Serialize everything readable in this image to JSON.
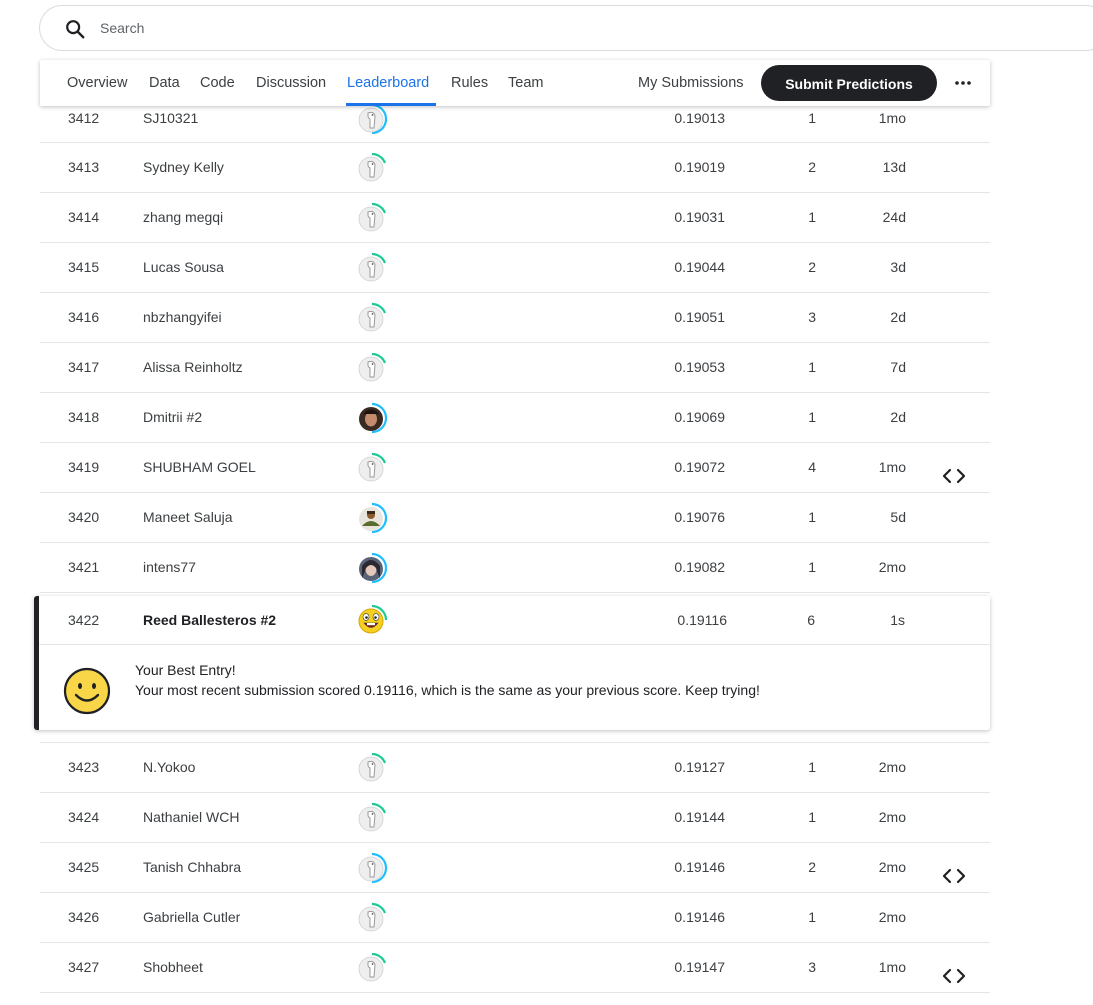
{
  "search": {
    "placeholder": "Search"
  },
  "nav": {
    "tabs": [
      {
        "label": "Overview"
      },
      {
        "label": "Data"
      },
      {
        "label": "Code"
      },
      {
        "label": "Discussion"
      },
      {
        "label": "Leaderboard"
      },
      {
        "label": "Rules"
      },
      {
        "label": "Team"
      }
    ],
    "my_submissions": "My Submissions",
    "submit": "Submit Predictions",
    "active_tab": "Leaderboard"
  },
  "rows_upper": [
    {
      "rank": "3412",
      "name": "SJ10321",
      "score": "0.19013",
      "entries": "1",
      "last": "1mo",
      "code": false,
      "avatar": "default",
      "ring": "blue"
    },
    {
      "rank": "3413",
      "name": "Sydney Kelly",
      "score": "0.19019",
      "entries": "2",
      "last": "13d",
      "code": false,
      "avatar": "default",
      "ring": "green"
    },
    {
      "rank": "3414",
      "name": "zhang megqi",
      "score": "0.19031",
      "entries": "1",
      "last": "24d",
      "code": false,
      "avatar": "default",
      "ring": "green"
    },
    {
      "rank": "3415",
      "name": "Lucas Sousa",
      "score": "0.19044",
      "entries": "2",
      "last": "3d",
      "code": false,
      "avatar": "default",
      "ring": "green"
    },
    {
      "rank": "3416",
      "name": "nbzhangyifei",
      "score": "0.19051",
      "entries": "3",
      "last": "2d",
      "code": false,
      "avatar": "default",
      "ring": "green"
    },
    {
      "rank": "3417",
      "name": "Alissa Reinholtz",
      "score": "0.19053",
      "entries": "1",
      "last": "7d",
      "code": false,
      "avatar": "default",
      "ring": "green"
    },
    {
      "rank": "3418",
      "name": "Dmitrii #2",
      "score": "0.19069",
      "entries": "1",
      "last": "2d",
      "code": false,
      "avatar": "photo-dark",
      "ring": "blue"
    },
    {
      "rank": "3419",
      "name": "SHUBHAM GOEL",
      "score": "0.19072",
      "entries": "4",
      "last": "1mo",
      "code": true,
      "avatar": "default",
      "ring": "green"
    },
    {
      "rank": "3420",
      "name": "Maneet Saluja",
      "score": "0.19076",
      "entries": "1",
      "last": "5d",
      "code": false,
      "avatar": "photo-person",
      "ring": "blue"
    },
    {
      "rank": "3421",
      "name": "intens77",
      "score": "0.19082",
      "entries": "1",
      "last": "2mo",
      "code": false,
      "avatar": "photo-face",
      "ring": "blue"
    }
  ],
  "best_entry": {
    "rank": "3422",
    "name": "Reed Ballesteros #2",
    "score": "0.19116",
    "entries": "6",
    "last": "1s",
    "title": "Your Best Entry!",
    "message": "Your most recent submission scored 0.19116, which is the same as your previous score. Keep trying!"
  },
  "rows_lower": [
    {
      "rank": "3423",
      "name": "N.Yokoo",
      "score": "0.19127",
      "entries": "1",
      "last": "2mo",
      "code": false,
      "avatar": "default",
      "ring": "green"
    },
    {
      "rank": "3424",
      "name": "Nathaniel WCH",
      "score": "0.19144",
      "entries": "1",
      "last": "2mo",
      "code": false,
      "avatar": "default",
      "ring": "green"
    },
    {
      "rank": "3425",
      "name": "Tanish Chhabra",
      "score": "0.19146",
      "entries": "2",
      "last": "2mo",
      "code": true,
      "avatar": "default",
      "ring": "blue"
    },
    {
      "rank": "3426",
      "name": "Gabriella Cutler",
      "score": "0.19146",
      "entries": "1",
      "last": "2mo",
      "code": false,
      "avatar": "default",
      "ring": "green"
    },
    {
      "rank": "3427",
      "name": "Shobheet",
      "score": "0.19147",
      "entries": "3",
      "last": "1mo",
      "code": true,
      "avatar": "default",
      "ring": "green"
    }
  ],
  "colors": {
    "accent": "#1a73e8",
    "ring_green": "#20BEFF",
    "ring_blue": "#20BEFF",
    "tier_green": "#20c997"
  }
}
